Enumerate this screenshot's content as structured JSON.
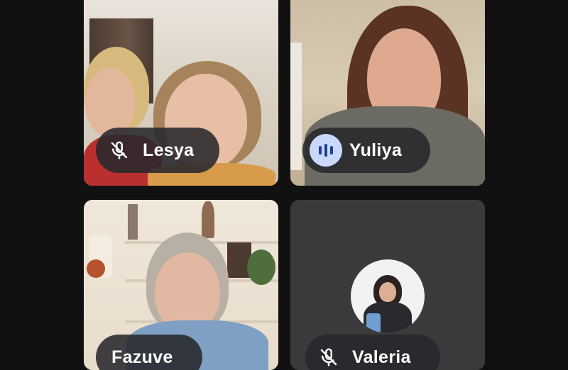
{
  "participants": [
    {
      "name": "Lesya",
      "mic": "muted",
      "icon": "mic-off-icon"
    },
    {
      "name": "Yuliya",
      "mic": "speaking",
      "icon": "audio-level-icon"
    },
    {
      "name": "Fazuve",
      "mic": "hidden",
      "icon": ""
    },
    {
      "name": "Valeria",
      "mic": "muted",
      "icon": "mic-off-icon",
      "video": "off"
    }
  ],
  "colors": {
    "background": "#111111",
    "tile_empty": "#3a3a3c",
    "pill_bg": "rgba(40,40,44,0.88)",
    "speaking_badge": "#c9d8fb",
    "speaking_bars": "#1f3f8f"
  }
}
